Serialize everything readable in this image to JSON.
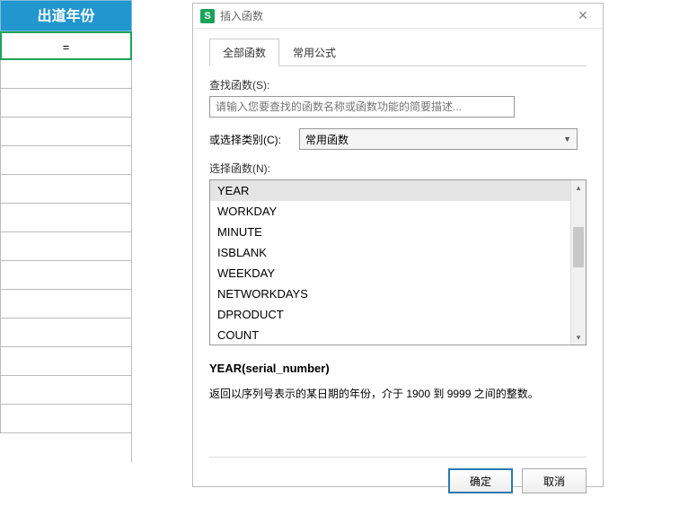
{
  "sheet": {
    "header": "出道年份",
    "active_cell_value": "="
  },
  "dialog": {
    "title": "插入函数",
    "app_icon_letter": "S",
    "tabs": {
      "all": "全部函数",
      "common": "常用公式"
    },
    "search_label": "查找函数(S):",
    "search_placeholder": "请输入您要查找的函数名称或函数功能的简要描述...",
    "category_label": "或选择类别(C):",
    "category_value": "常用函数",
    "select_fn_label": "选择函数(N):",
    "functions": [
      "YEAR",
      "WORKDAY",
      "MINUTE",
      "ISBLANK",
      "WEEKDAY",
      "NETWORKDAYS",
      "DPRODUCT",
      "COUNT"
    ],
    "syntax": "YEAR(serial_number)",
    "description": "返回以序列号表示的某日期的年份，介于 1900 到 9999 之间的整数。",
    "ok": "确定",
    "cancel": "取消"
  }
}
